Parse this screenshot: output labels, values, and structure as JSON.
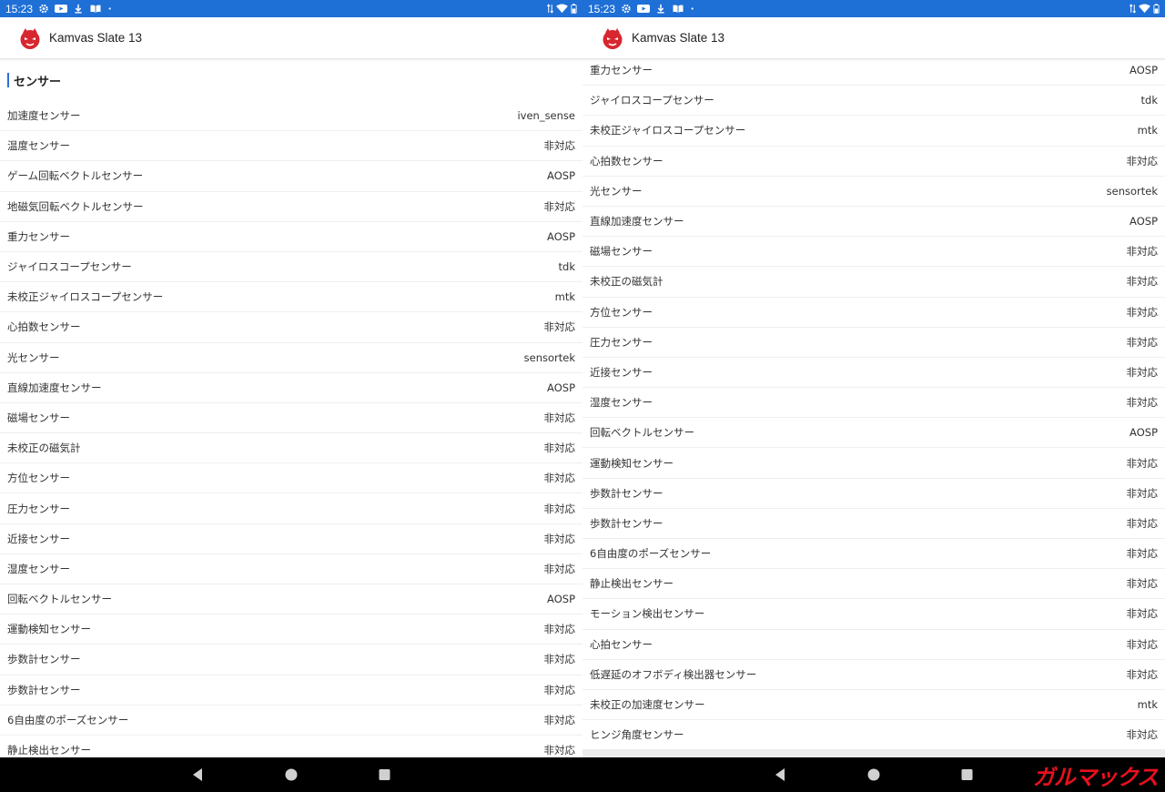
{
  "status_bar": {
    "time": "15:23"
  },
  "app_title": "Kamvas Slate 13",
  "section_title": "センサー",
  "left_rows": [
    {
      "label": "加速度センサー",
      "value": "iven_sense"
    },
    {
      "label": "温度センサー",
      "value": "非対応"
    },
    {
      "label": "ゲーム回転ベクトルセンサー",
      "value": "AOSP"
    },
    {
      "label": "地磁気回転ベクトルセンサー",
      "value": "非対応"
    },
    {
      "label": "重力センサー",
      "value": "AOSP"
    },
    {
      "label": "ジャイロスコープセンサー",
      "value": "tdk"
    },
    {
      "label": "未校正ジャイロスコープセンサー",
      "value": "mtk"
    },
    {
      "label": "心拍数センサー",
      "value": "非対応"
    },
    {
      "label": "光センサー",
      "value": "sensortek"
    },
    {
      "label": "直線加速度センサー",
      "value": "AOSP"
    },
    {
      "label": "磁場センサー",
      "value": "非対応"
    },
    {
      "label": "未校正の磁気計",
      "value": "非対応"
    },
    {
      "label": "方位センサー",
      "value": "非対応"
    },
    {
      "label": "圧力センサー",
      "value": "非対応"
    },
    {
      "label": "近接センサー",
      "value": "非対応"
    },
    {
      "label": "湿度センサー",
      "value": "非対応"
    },
    {
      "label": "回転ベクトルセンサー",
      "value": "AOSP"
    },
    {
      "label": "運動検知センサー",
      "value": "非対応"
    },
    {
      "label": "歩数計センサー",
      "value": "非対応"
    },
    {
      "label": "歩数計センサー",
      "value": "非対応"
    },
    {
      "label": "6自由度のポーズセンサー",
      "value": "非対応"
    },
    {
      "label": "静止検出センサー",
      "value": "非対応"
    }
  ],
  "right_rows": [
    {
      "label": "重力センサー",
      "value": "AOSP"
    },
    {
      "label": "ジャイロスコープセンサー",
      "value": "tdk"
    },
    {
      "label": "未校正ジャイロスコープセンサー",
      "value": "mtk"
    },
    {
      "label": "心拍数センサー",
      "value": "非対応"
    },
    {
      "label": "光センサー",
      "value": "sensortek"
    },
    {
      "label": "直線加速度センサー",
      "value": "AOSP"
    },
    {
      "label": "磁場センサー",
      "value": "非対応"
    },
    {
      "label": "未校正の磁気計",
      "value": "非対応"
    },
    {
      "label": "方位センサー",
      "value": "非対応"
    },
    {
      "label": "圧力センサー",
      "value": "非対応"
    },
    {
      "label": "近接センサー",
      "value": "非対応"
    },
    {
      "label": "湿度センサー",
      "value": "非対応"
    },
    {
      "label": "回転ベクトルセンサー",
      "value": "AOSP"
    },
    {
      "label": "運動検知センサー",
      "value": "非対応"
    },
    {
      "label": "歩数計センサー",
      "value": "非対応"
    },
    {
      "label": "歩数計センサー",
      "value": "非対応"
    },
    {
      "label": "6自由度のポーズセンサー",
      "value": "非対応"
    },
    {
      "label": "静止検出センサー",
      "value": "非対応"
    },
    {
      "label": "モーション検出センサー",
      "value": "非対応"
    },
    {
      "label": "心拍センサー",
      "value": "非対応"
    },
    {
      "label": "低遅延のオフボディ検出器センサー",
      "value": "非対応"
    },
    {
      "label": "未校正の加速度センサー",
      "value": "mtk"
    },
    {
      "label": "ヒンジ角度センサー",
      "value": "非対応"
    }
  ],
  "watermark": "ガルマックス",
  "colors": {
    "status_bar": "#1e6fd6",
    "accent": "#2a6fd6",
    "watermark": "#e8101e"
  },
  "icons": [
    "gear-icon",
    "youtube-icon",
    "download-icon",
    "book-icon",
    "dot-icon",
    "data-arrows-icon",
    "wifi-icon",
    "battery-icon",
    "app-logo-icon",
    "back-icon",
    "home-icon",
    "recents-icon"
  ]
}
